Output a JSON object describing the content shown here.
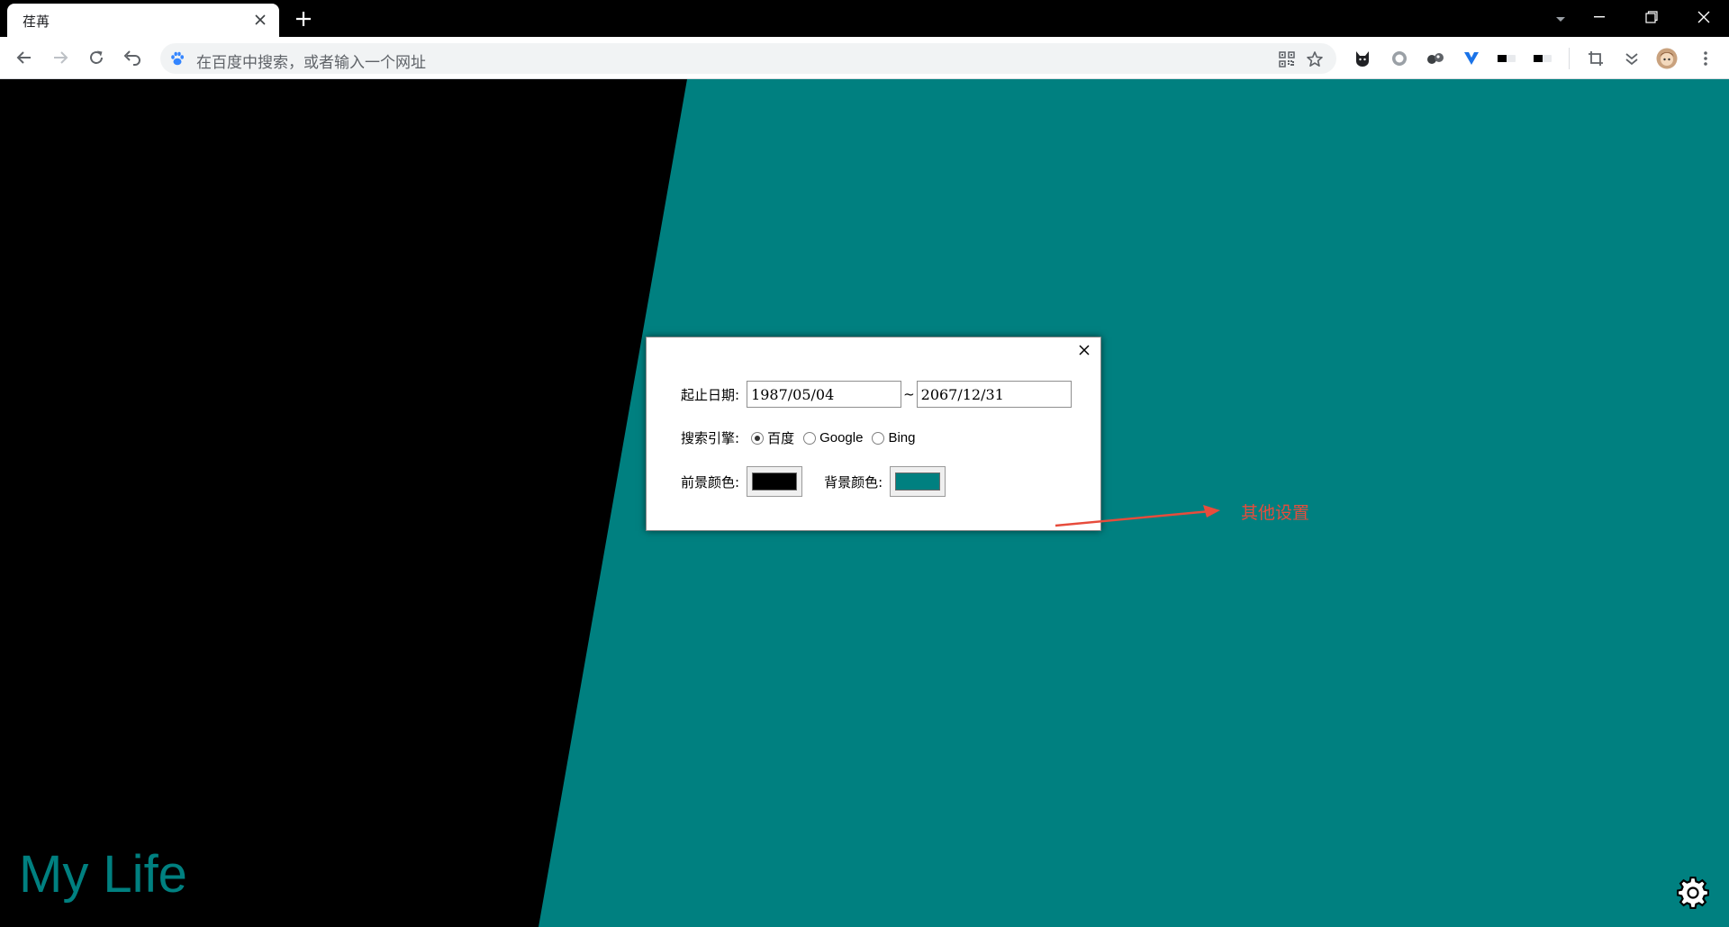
{
  "browser": {
    "tab_title": "荏苒",
    "omnibox_placeholder": "在百度中搜索，或者输入一个网址"
  },
  "page": {
    "brand": "My Life",
    "foreground_color": "#000000",
    "background_color": "#008080"
  },
  "settings": {
    "date_label": "起止日期:",
    "start_date": "1987/05/04",
    "separator": "~",
    "end_date": "2067/12/31",
    "engine_label": "搜索引擎:",
    "engines": [
      {
        "label": "百度",
        "selected": true
      },
      {
        "label": "Google",
        "selected": false
      },
      {
        "label": "Bing",
        "selected": false
      }
    ],
    "fg_label": "前景颜色:",
    "bg_label": "背景颜色:"
  },
  "annotation": {
    "text": "其他设置",
    "color": "#e74c3c"
  }
}
